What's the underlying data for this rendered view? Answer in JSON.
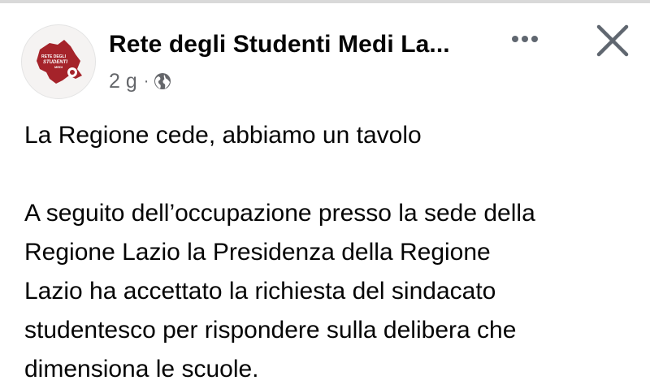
{
  "post": {
    "author": "Rete degli Studenti Medi La...",
    "time": "2 g",
    "separator": "·",
    "audience_icon": "globe-icon",
    "avatar_logo_text": "RETE DEGLI STUDENTI MEDI",
    "title": "La Regione cede, abbiamo un tavolo",
    "body_lines": [
      "A seguito dell’occupazione presso la sede della",
      "Regione Lazio la Presidenza della Regione",
      "Lazio ha accettato la richiesta del sindacato",
      "studentesco per rispondere sulla delibera che",
      "dimensiona le scuole."
    ]
  },
  "actions": {
    "more_icon": "more-options-icon",
    "close_icon": "close-icon"
  },
  "colors": {
    "brand": "#a5232a",
    "text": "#050505",
    "secondary_text": "#65676b"
  }
}
